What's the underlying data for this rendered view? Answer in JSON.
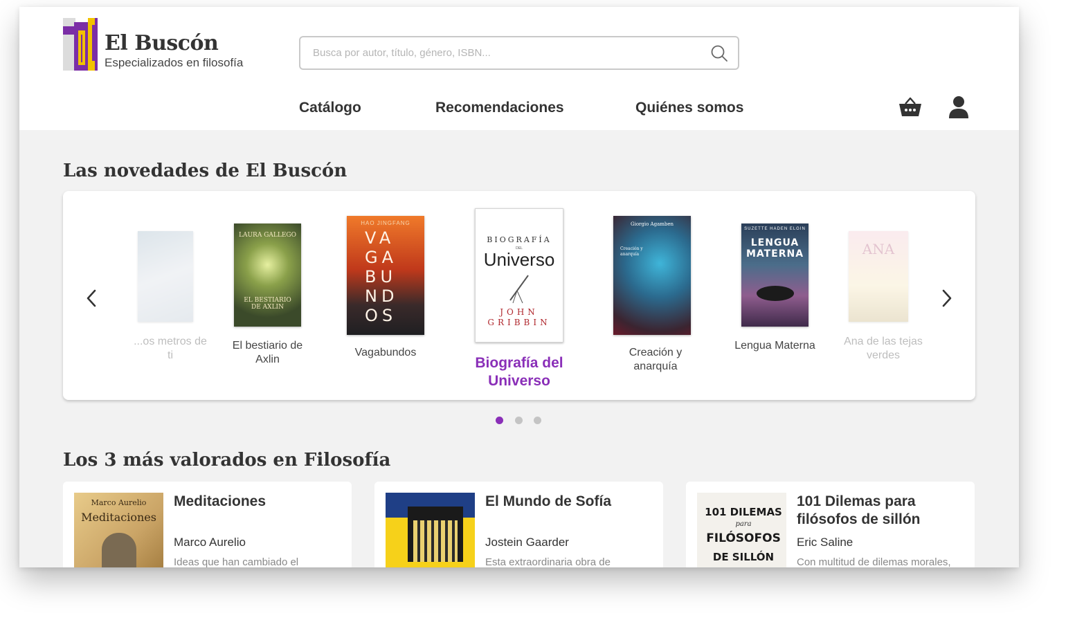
{
  "brand": {
    "name": "El Buscón",
    "tagline": "Especializados en filosofía"
  },
  "search": {
    "placeholder": "Busca por autor, título, género, ISBN..."
  },
  "nav": {
    "catalog": "Catálogo",
    "recommendations": "Recomendaciones",
    "about": "Quiénes somos"
  },
  "new_section": {
    "title": "Las novedades de El Buscón",
    "books": [
      {
        "title": "...os metros de ti"
      },
      {
        "title": "El bestiario de Axlin"
      },
      {
        "title": "Vagabundos"
      },
      {
        "title": "Biografía del Universo"
      },
      {
        "title": "Creación y anarquía"
      },
      {
        "title": "Lengua Materna"
      },
      {
        "title": "Ana de las tejas verdes"
      }
    ],
    "covers": {
      "laura_author": "LAURA GALLEGO",
      "bestiario": "EL BESTIARIO DE AXLIN",
      "hao": "HAO JINGFANG",
      "vagabundos_lines": [
        "VA",
        "GA",
        "BU",
        "ND",
        "OS"
      ],
      "biografia_top": "BIOGRAFÍA",
      "biografia_del": "DEL",
      "universo": "Universo",
      "john": "JOHN",
      "gribbin": "GRIBBIN",
      "agamben": "Giorgio Agamben",
      "creacion_small": "Creación y anarquía",
      "suzette": "SUZETTE HADEN ELGIN",
      "lengua": "LENGUA",
      "materna": "MATERNA",
      "ana": "ANA"
    }
  },
  "top_section": {
    "title": "Los 3 más valorados en Filosofía",
    "cards": [
      {
        "title": "Meditaciones",
        "author": "Marco Aurelio",
        "desc": "Ideas que han cambiado el",
        "cover_author": "Marco Aurelio",
        "cover_title": "Meditaciones"
      },
      {
        "title": "El Mundo de Sofía",
        "author": "Jostein Gaarder",
        "desc": "Esta extraordinaria obra de"
      },
      {
        "title": "101 Dilemas para filósofos de sillón",
        "author": "Eric Saline",
        "desc": "Con multitud de dilemas morales,",
        "cover_lines": [
          "101 DILEMAS",
          "para",
          "FILÓSOFOS",
          "DE SILLÓN"
        ]
      }
    ]
  },
  "colors": {
    "accent": "#8a2fb8",
    "logo_purple": "#7b2ea6",
    "logo_yellow": "#f2c200",
    "logo_gray": "#d9d9d9"
  },
  "pagination": {
    "active_index": 0,
    "total": 3
  }
}
